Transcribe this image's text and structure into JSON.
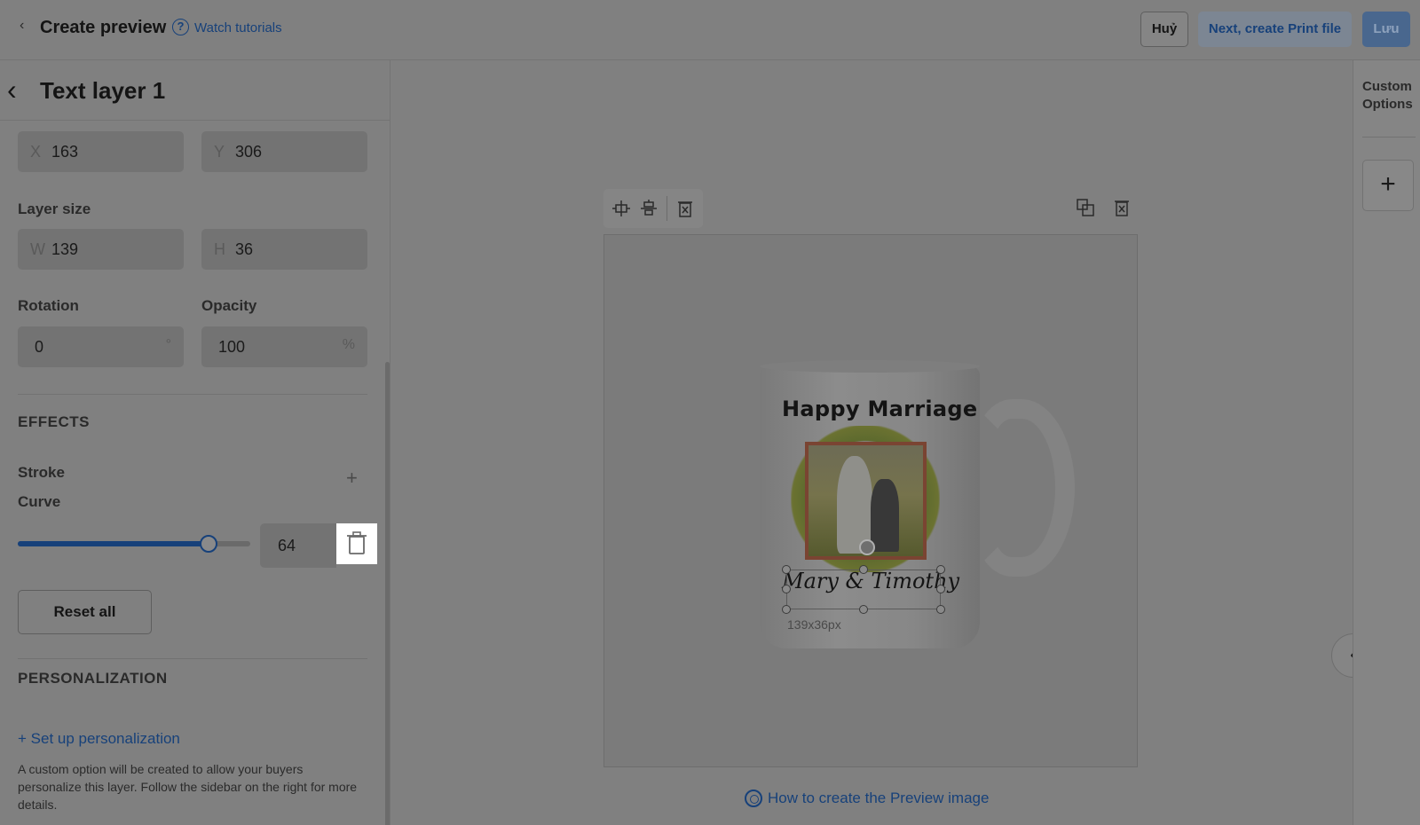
{
  "header": {
    "back_glyph": "‹",
    "title": "Create preview",
    "help_glyph": "?",
    "watch_tutorials": "Watch tutorials",
    "cancel_label": "Huỷ",
    "next_label": "Next, create Print file",
    "save_label": "Lưu"
  },
  "layer_panel": {
    "back_glyph": "‹",
    "title": "Text layer 1",
    "position": {
      "x_prefix": "X",
      "x_value": "163",
      "y_prefix": "Y",
      "y_value": "306"
    },
    "layer_size": {
      "label": "Layer size",
      "w_prefix": "W",
      "w_value": "139",
      "h_prefix": "H",
      "h_value": "36"
    },
    "rotation": {
      "label": "Rotation",
      "value": "0",
      "unit": "°"
    },
    "opacity": {
      "label": "Opacity",
      "value": "100",
      "unit": "%"
    },
    "effects": {
      "heading": "EFFECTS",
      "stroke_label": "Stroke",
      "stroke_add_glyph": "+",
      "curve_label": "Curve",
      "curve_value": "64",
      "curve_slider_fraction": 0.82
    },
    "reset_label": "Reset all",
    "personalization": {
      "heading": "PERSONALIZATION",
      "setup_link": "+ Set up personalization",
      "help_text": "A custom option will be created to allow your buyers personalize this layer. Follow the sidebar on the right for more details."
    }
  },
  "canvas": {
    "mug_title": "Happy Marriage",
    "mug_names": "Mary & Timothy",
    "selection_size_label": "139x36px",
    "howto_link": "How to create the Preview image"
  },
  "right_sidebar": {
    "title": "Custom Options",
    "add_glyph": "+",
    "collapse_glyph": "‹"
  },
  "colors": {
    "accent": "#17417a",
    "overlay": "#808080",
    "highlight": "#ffffff"
  }
}
